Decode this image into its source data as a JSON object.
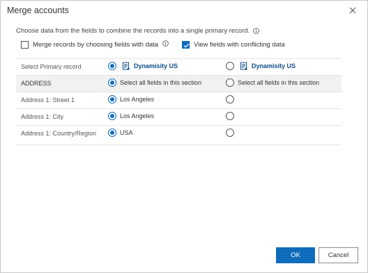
{
  "dialog": {
    "title": "Merge accounts",
    "close_icon": "close-icon",
    "instructions": "Choose data from the fields to combine the records into a single primary record.",
    "options": {
      "merge_by_data_label": "Merge records by choosing fields with data",
      "merge_by_data_checked": false,
      "conflicting_label": "View fields with conflicting data",
      "conflicting_checked": true
    },
    "rows": [
      {
        "label": "Select Primary record",
        "type": "primary",
        "col1": "Dynamisity US",
        "col2": "Dynamisity US",
        "selected": 1
      },
      {
        "label": "ADDRESS",
        "type": "section",
        "col1": "Select all fields in this section",
        "col2": "Select all fields in this section",
        "selected": 1
      },
      {
        "label": "Address 1: Street 1",
        "type": "field",
        "col1": "Los Angeles",
        "col2": "",
        "selected": 1
      },
      {
        "label": "Address 1: City",
        "type": "field",
        "col1": "Los Angeles",
        "col2": "",
        "selected": 1
      },
      {
        "label": "Address 1: Country/Region",
        "type": "field",
        "col1": "USA",
        "col2": "",
        "selected": 1
      }
    ],
    "buttons": {
      "ok": "OK",
      "cancel": "Cancel"
    },
    "colors": {
      "accent": "#0f6cbd",
      "record_link": "#0f4c8a"
    }
  }
}
